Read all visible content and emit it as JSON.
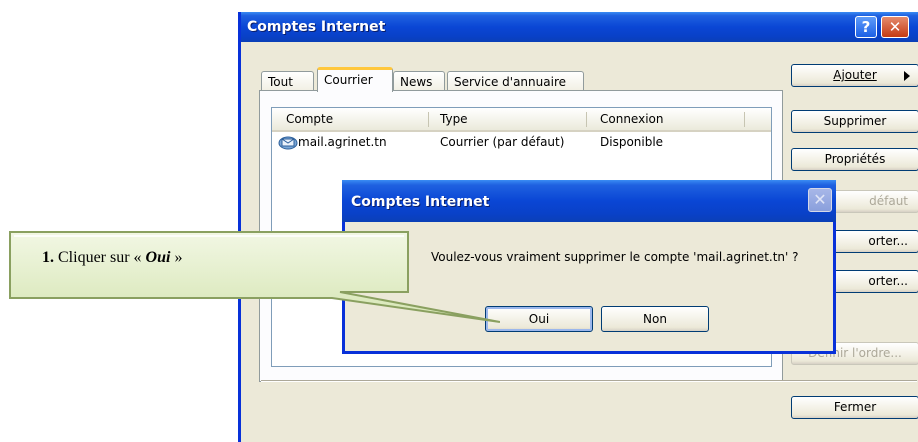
{
  "main_window": {
    "title": "Comptes Internet",
    "help_glyph": "?",
    "close_glyph": "✕",
    "tabs": [
      {
        "label": "Tout",
        "active": false
      },
      {
        "label": "Courrier",
        "active": true
      },
      {
        "label": "News",
        "active": false
      },
      {
        "label": "Service d'annuaire",
        "active": false
      }
    ],
    "columns": [
      "Compte",
      "Type",
      "Connexion"
    ],
    "rows": [
      {
        "compte": "mail.agrinet.tn",
        "type": "Courrier (par défaut)",
        "connexion": "Disponible",
        "icon": "mail-account-icon"
      }
    ],
    "buttons": {
      "ajouter": "Ajouter",
      "supprimer": "Supprimer",
      "proprietes": "Propriétés",
      "defaut_partial": "défaut",
      "importer_partial": "orter...",
      "exporter_partial": "orter...",
      "ordre_partial": "Définir l'ordre...",
      "fermer": "Fermer"
    }
  },
  "confirm_dialog": {
    "title": "Comptes Internet",
    "message": "Voulez-vous vraiment supprimer le compte 'mail.agrinet.tn' ?",
    "yes": "Oui",
    "no": "Non"
  },
  "callout": {
    "number": "1.",
    "prefix": "Cliquer sur «",
    "emphasis": "Oui",
    "suffix": "»"
  },
  "colors": {
    "titlebar": "#0a46d5",
    "window_face": "#ece9d8",
    "callout_fill": "#e6f0cf",
    "callout_border": "#8aa060"
  }
}
